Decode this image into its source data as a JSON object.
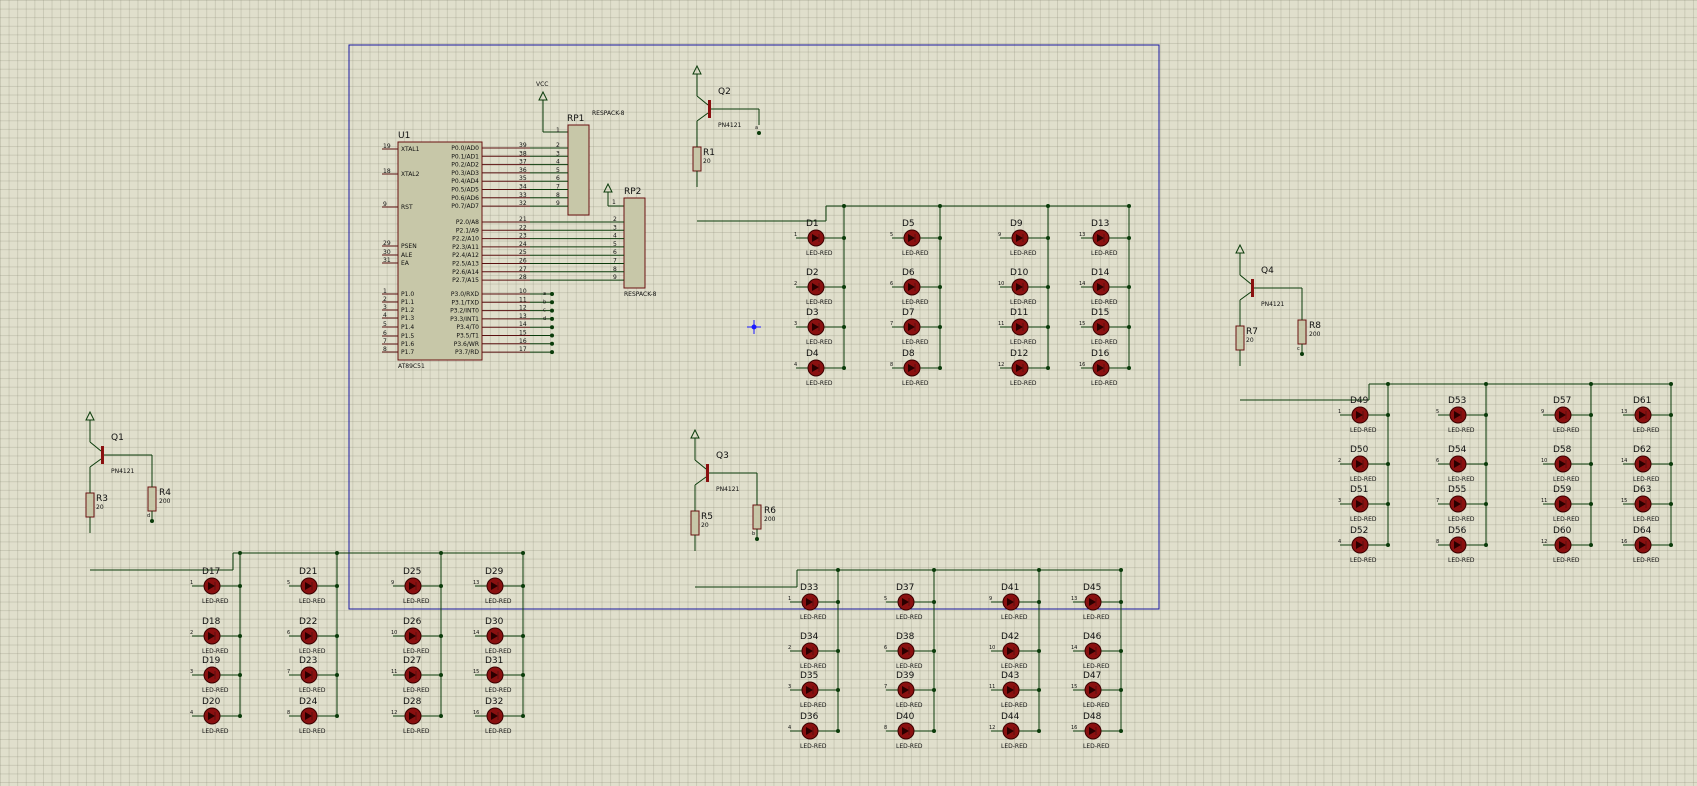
{
  "colors": {
    "background": "#e0dfcc",
    "wire": "#0a3b0a",
    "component": "#8a1010",
    "frame": "#1a1aa0"
  },
  "mcu": {
    "ref": "U1",
    "part": "AT89C51",
    "left_pins": [
      {
        "num": "19",
        "name": "XTAL1"
      },
      {
        "num": "18",
        "name": "XTAL2"
      },
      {
        "num": "9",
        "name": "RST"
      },
      {
        "num": "29",
        "name": "PSEN"
      },
      {
        "num": "30",
        "name": "ALE"
      },
      {
        "num": "31",
        "name": "EA"
      },
      {
        "num": "1",
        "name": "P1.0"
      },
      {
        "num": "2",
        "name": "P1.1"
      },
      {
        "num": "3",
        "name": "P1.2"
      },
      {
        "num": "4",
        "name": "P1.3"
      },
      {
        "num": "5",
        "name": "P1.4"
      },
      {
        "num": "6",
        "name": "P1.5"
      },
      {
        "num": "7",
        "name": "P1.6"
      },
      {
        "num": "8",
        "name": "P1.7"
      }
    ],
    "right_pins": [
      {
        "num": "39",
        "name": "P0.0/AD0"
      },
      {
        "num": "38",
        "name": "P0.1/AD1"
      },
      {
        "num": "37",
        "name": "P0.2/AD2"
      },
      {
        "num": "36",
        "name": "P0.3/AD3"
      },
      {
        "num": "35",
        "name": "P0.4/AD4"
      },
      {
        "num": "34",
        "name": "P0.5/AD5"
      },
      {
        "num": "33",
        "name": "P0.6/AD6"
      },
      {
        "num": "32",
        "name": "P0.7/AD7"
      },
      {
        "num": "21",
        "name": "P2.0/A8"
      },
      {
        "num": "22",
        "name": "P2.1/A9"
      },
      {
        "num": "23",
        "name": "P2.2/A10"
      },
      {
        "num": "24",
        "name": "P2.3/A11"
      },
      {
        "num": "25",
        "name": "P2.4/A12"
      },
      {
        "num": "26",
        "name": "P2.5/A13"
      },
      {
        "num": "27",
        "name": "P2.6/A14"
      },
      {
        "num": "28",
        "name": "P2.7/A15"
      },
      {
        "num": "10",
        "name": "P3.0/RXD"
      },
      {
        "num": "11",
        "name": "P3.1/TXD"
      },
      {
        "num": "12",
        "name": "P3.2/INT0"
      },
      {
        "num": "13",
        "name": "P3.3/INT1"
      },
      {
        "num": "14",
        "name": "P3.4/T0"
      },
      {
        "num": "15",
        "name": "P3.5/T1"
      },
      {
        "num": "16",
        "name": "P3.6/WR"
      },
      {
        "num": "17",
        "name": "P3.7/RD"
      }
    ],
    "p3_wire_labels": [
      "a",
      "b",
      "c",
      "d"
    ]
  },
  "resistor_packs": [
    {
      "ref": "RP1",
      "part": "RESPACK-8",
      "common": "1",
      "pins": [
        "2",
        "3",
        "4",
        "5",
        "6",
        "7",
        "8",
        "9"
      ]
    },
    {
      "ref": "RP2",
      "part": "RESPACK-8",
      "common": "1",
      "pins": [
        "2",
        "3",
        "4",
        "5",
        "6",
        "7",
        "8",
        "9"
      ]
    }
  ],
  "power": {
    "vcc": "VCC"
  },
  "transistors": [
    {
      "ref": "Q1",
      "part": "PN4121",
      "r_base": {
        "ref": "R3",
        "value": "20"
      },
      "r_emitter": {
        "ref": "R4",
        "value": "200",
        "tag": "d"
      }
    },
    {
      "ref": "Q2",
      "part": "PN4121",
      "r_base": {
        "ref": "R1",
        "value": "20"
      },
      "tag": "a"
    },
    {
      "ref": "Q3",
      "part": "PN4121",
      "r_base": {
        "ref": "R5",
        "value": "20"
      },
      "r_emitter": {
        "ref": "R6",
        "value": "200",
        "tag": "b"
      }
    },
    {
      "ref": "Q4",
      "part": "PN4121",
      "r_base": {
        "ref": "R7",
        "value": "20"
      },
      "r_emitter": {
        "ref": "R8",
        "value": "200",
        "tag": "c"
      }
    }
  ],
  "led_part": "LED-RED",
  "led_blocks": [
    {
      "id": "q2-block",
      "names": [
        "D1",
        "D5",
        "D9",
        "D13",
        "D2",
        "D6",
        "D10",
        "D14",
        "D3",
        "D7",
        "D11",
        "D15",
        "D4",
        "D8",
        "D12",
        "D16"
      ]
    },
    {
      "id": "q1-block",
      "names": [
        "D17",
        "D21",
        "D25",
        "D29",
        "D18",
        "D22",
        "D26",
        "D30",
        "D19",
        "D23",
        "D27",
        "D31",
        "D20",
        "D24",
        "D28",
        "D32"
      ]
    },
    {
      "id": "q3-block",
      "names": [
        "D33",
        "D37",
        "D41",
        "D45",
        "D34",
        "D38",
        "D42",
        "D46",
        "D35",
        "D39",
        "D43",
        "D47",
        "D36",
        "D40",
        "D44",
        "D48"
      ]
    },
    {
      "id": "q4-block",
      "names": [
        "D49",
        "D53",
        "D57",
        "D61",
        "D50",
        "D54",
        "D58",
        "D62",
        "D51",
        "D55",
        "D59",
        "D63",
        "D52",
        "D56",
        "D60",
        "D64"
      ]
    }
  ],
  "led_pin_labels": [
    "1",
    "5",
    "9",
    "13",
    "2",
    "6",
    "10",
    "14",
    "3",
    "7",
    "11",
    "15",
    "4",
    "8",
    "12",
    "16"
  ]
}
